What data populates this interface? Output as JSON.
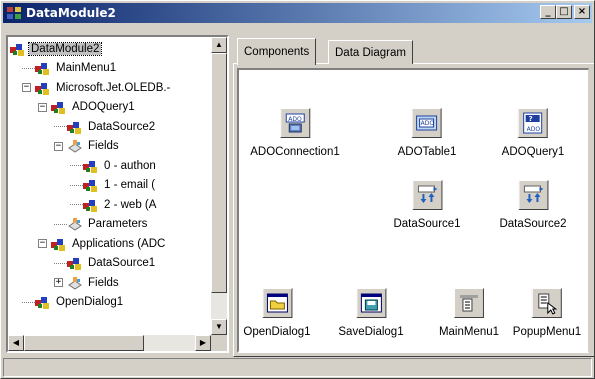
{
  "window": {
    "title": "DataModule2"
  },
  "title_buttons": {
    "minimize": "_",
    "maximize": "□",
    "close": "×"
  },
  "tree": {
    "items": [
      {
        "label": "DataModule2",
        "level": 0,
        "expander": "",
        "icon": "component-icon",
        "selected": true
      },
      {
        "label": "MainMenu1",
        "level": 1,
        "expander": "",
        "icon": "component-icon"
      },
      {
        "label": "Microsoft.Jet.OLEDB.-",
        "level": 1,
        "expander": "−",
        "icon": "component-icon"
      },
      {
        "label": "ADOQuery1",
        "level": 2,
        "expander": "−",
        "icon": "component-icon"
      },
      {
        "label": "DataSource2",
        "level": 3,
        "expander": "",
        "icon": "component-icon"
      },
      {
        "label": "Fields",
        "level": 3,
        "expander": "−",
        "icon": "fields-icon"
      },
      {
        "label": "0 - authon",
        "level": 4,
        "expander": "",
        "icon": "component-icon"
      },
      {
        "label": "1 - email (",
        "level": 4,
        "expander": "",
        "icon": "component-icon"
      },
      {
        "label": "2 - web (A",
        "level": 4,
        "expander": "",
        "icon": "component-icon"
      },
      {
        "label": "Parameters",
        "level": 3,
        "expander": "",
        "icon": "fields-icon"
      },
      {
        "label": "Applications (ADC",
        "level": 2,
        "expander": "−",
        "icon": "component-icon"
      },
      {
        "label": "DataSource1",
        "level": 3,
        "expander": "",
        "icon": "component-icon"
      },
      {
        "label": "Fields",
        "level": 3,
        "expander": "+",
        "icon": "fields-icon"
      },
      {
        "label": "OpenDialog1",
        "level": 1,
        "expander": "",
        "icon": "component-icon"
      }
    ]
  },
  "tabs": [
    {
      "label": "Components",
      "active": true
    },
    {
      "label": "Data Diagram",
      "active": false
    }
  ],
  "components": [
    {
      "label": "ADOConnection1",
      "icon": "ado-connection-icon"
    },
    {
      "label": "ADOTable1",
      "icon": "ado-table-icon"
    },
    {
      "label": "ADOQuery1",
      "icon": "ado-query-icon"
    },
    {
      "label": "DataSource1",
      "icon": "datasource-icon"
    },
    {
      "label": "DataSource2",
      "icon": "datasource-icon"
    },
    {
      "label": "OpenDialog1",
      "icon": "open-dialog-icon"
    },
    {
      "label": "SaveDialog1",
      "icon": "save-dialog-icon"
    },
    {
      "label": "MainMenu1",
      "icon": "main-menu-icon"
    },
    {
      "label": "PopupMenu1",
      "icon": "popup-menu-icon"
    }
  ],
  "colors": {
    "titlebar_start": "#0a246a",
    "titlebar_end": "#a6caf0",
    "face": "#d4d0c8"
  }
}
